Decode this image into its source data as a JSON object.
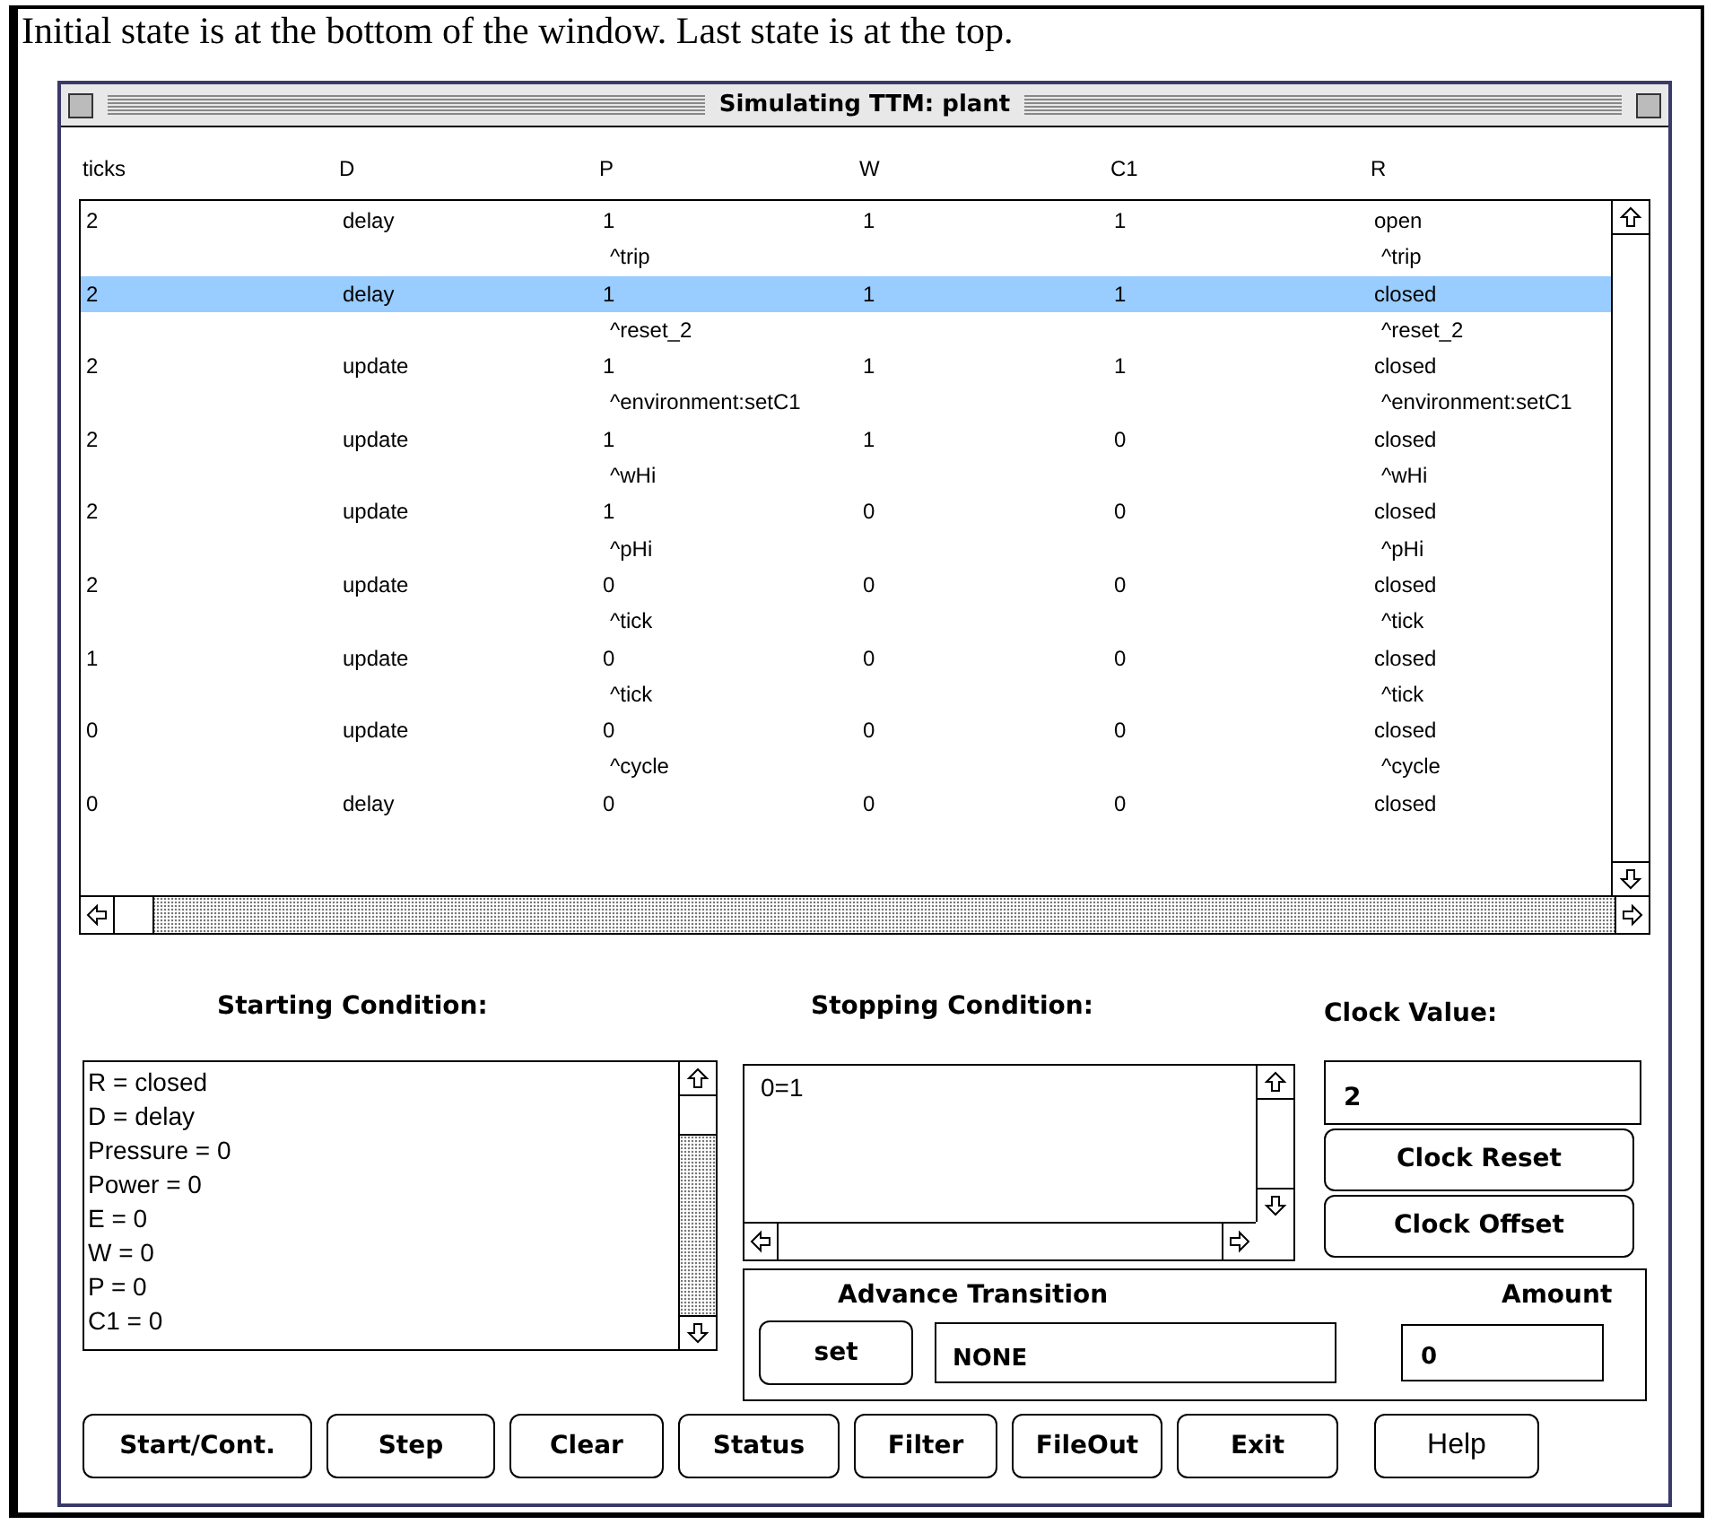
{
  "caption": "Initial state is at the bottom of the window. Last state is at the top.",
  "window": {
    "title": "Simulating TTM: plant"
  },
  "table": {
    "columns": [
      "ticks",
      "D",
      "P",
      "W",
      "C1",
      "R"
    ],
    "rows": [
      {
        "ticks": "2",
        "d": "delay",
        "p": "1",
        "w": "1",
        "c1": "1",
        "r": "open",
        "event_p": "^trip",
        "event_r": "^trip",
        "selected": false
      },
      {
        "ticks": "2",
        "d": "delay",
        "p": "1",
        "w": "1",
        "c1": "1",
        "r": "closed",
        "event_p": "^reset_2",
        "event_r": "^reset_2",
        "selected": true
      },
      {
        "ticks": "2",
        "d": "update",
        "p": "1",
        "w": "1",
        "c1": "1",
        "r": "closed",
        "event_p": "^environment:setC1",
        "event_r": "^environment:setC1",
        "selected": false
      },
      {
        "ticks": "2",
        "d": "update",
        "p": "1",
        "w": "1",
        "c1": "0",
        "r": "closed",
        "event_p": "^wHi",
        "event_r": "^wHi",
        "selected": false
      },
      {
        "ticks": "2",
        "d": "update",
        "p": "1",
        "w": "0",
        "c1": "0",
        "r": "closed",
        "event_p": "^pHi",
        "event_r": "^pHi",
        "selected": false
      },
      {
        "ticks": "2",
        "d": "update",
        "p": "0",
        "w": "0",
        "c1": "0",
        "r": "closed",
        "event_p": "^tick",
        "event_r": "^tick",
        "selected": false
      },
      {
        "ticks": "1",
        "d": "update",
        "p": "0",
        "w": "0",
        "c1": "0",
        "r": "closed",
        "event_p": "^tick",
        "event_r": "^tick",
        "selected": false
      },
      {
        "ticks": "0",
        "d": "update",
        "p": "0",
        "w": "0",
        "c1": "0",
        "r": "closed",
        "event_p": "^cycle",
        "event_r": "^cycle",
        "selected": false
      },
      {
        "ticks": "0",
        "d": "delay",
        "p": "0",
        "w": "0",
        "c1": "0",
        "r": "closed",
        "selected": false
      }
    ]
  },
  "starting_condition": {
    "label": "Starting Condition:",
    "lines": [
      "R = closed",
      "D = delay",
      "Pressure = 0",
      "Power = 0",
      "E = 0",
      "W = 0",
      "P = 0",
      "C1 = 0"
    ]
  },
  "stopping_condition": {
    "label": "Stopping Condition:",
    "lines": [
      "0=1"
    ]
  },
  "clock": {
    "label": "Clock Value:",
    "value": "2",
    "buttons": [
      "Clock Reset",
      "Clock Offset"
    ]
  },
  "advance_transition": {
    "label": "Advance Transition",
    "button": "set",
    "value": "NONE",
    "amount_label": "Amount",
    "amount": "0"
  },
  "buttons": [
    {
      "label": "Start/Cont.",
      "kind": "bold"
    },
    {
      "label": "Step",
      "kind": "bold"
    },
    {
      "label": "Clear",
      "kind": "bold"
    },
    {
      "label": "Status",
      "kind": "bold"
    },
    {
      "label": "Filter",
      "kind": "bold"
    },
    {
      "label": "FileOut",
      "kind": "bold"
    },
    {
      "label": "Exit",
      "kind": "bold"
    },
    {
      "label": "Help",
      "kind": "plain"
    }
  ]
}
